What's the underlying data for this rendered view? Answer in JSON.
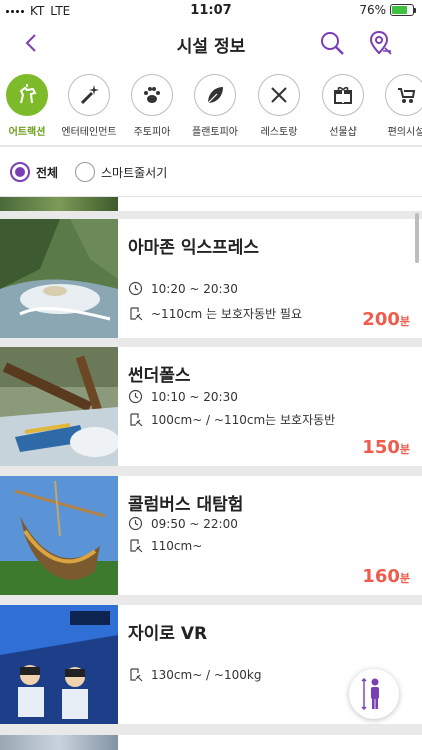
{
  "status": {
    "carrier": "KT",
    "network": "LTE",
    "time": "11:07",
    "battery": "76%",
    "battery_level": 0.76
  },
  "header": {
    "title": "시설 정보"
  },
  "categories": [
    {
      "label": "어트랙션",
      "icon": "carousel-horse-icon",
      "active": true
    },
    {
      "label": "엔터테인먼트",
      "icon": "magic-wand-icon",
      "active": false
    },
    {
      "label": "주토피아",
      "icon": "paw-icon",
      "active": false
    },
    {
      "label": "플랜토피아",
      "icon": "leaf-icon",
      "active": false
    },
    {
      "label": "레스토랑",
      "icon": "fork-knife-icon",
      "active": false
    },
    {
      "label": "선물샵",
      "icon": "gift-icon",
      "active": false
    },
    {
      "label": "편의시설",
      "icon": "stroller-icon",
      "active": false
    }
  ],
  "filter": {
    "all": "전체",
    "smart": "스마트줄서기",
    "selected": "all"
  },
  "items": [
    {
      "name": "아마존 익스프레스",
      "hours": "10:20 ~ 20:30",
      "requirement": "~110cm 는 보호자동반 필요",
      "wait": "200",
      "unit": "분"
    },
    {
      "name": "썬더폴스",
      "hours": "10:10 ~ 20:30",
      "requirement": "100cm~ / ~110cm는 보호자동반",
      "wait": "150",
      "unit": "분"
    },
    {
      "name": "콜럼버스 대탐험",
      "hours": "09:50 ~ 22:00",
      "requirement": "110cm~",
      "wait": "160",
      "unit": "분"
    },
    {
      "name": "자이로 VR",
      "hours": "",
      "requirement": "130cm~ / ~100kg",
      "wait": "",
      "unit": ""
    }
  ],
  "colors": {
    "accent": "#7b3fb5",
    "active_category": "#7dbb2a",
    "wait": "#ef5b4d"
  }
}
